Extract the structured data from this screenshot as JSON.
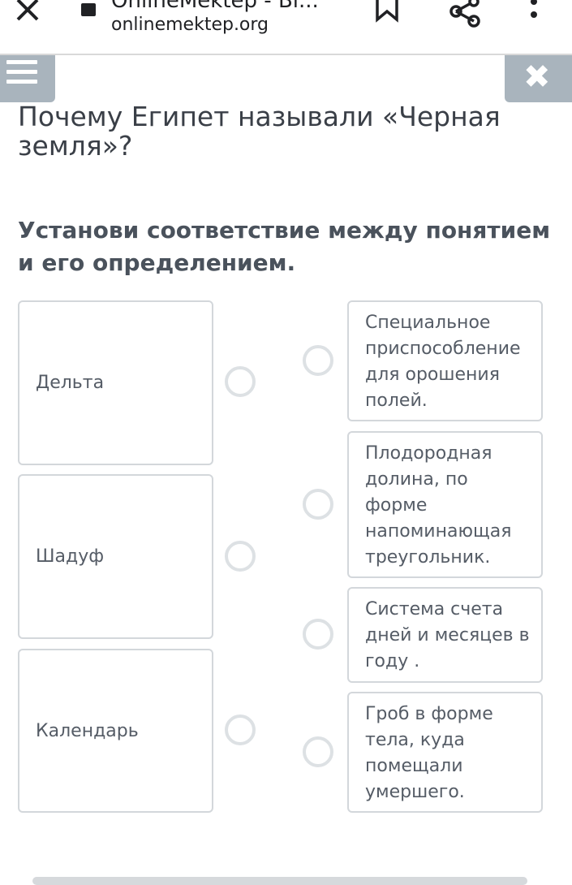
{
  "browser": {
    "page_title": "OnlineMektep - Bi...",
    "url": "onlinemektep.org"
  },
  "quiz": {
    "question": "Почему Египет называли «Черная земля»?",
    "instruction": "Установи соответствие между понятием и его определением.",
    "terms": [
      {
        "label": "Дельта"
      },
      {
        "label": "Шадуф"
      },
      {
        "label": "Календарь"
      }
    ],
    "definitions": [
      {
        "label": "Специальное приспособление для орошения полей."
      },
      {
        "label": "Плодородная долина, по форме напоминающая треугольник."
      },
      {
        "label": "Система счета дней и месяцев в году ."
      },
      {
        "label": "Гроб в форме тела, куда помещали умершего."
      }
    ]
  },
  "icons": {
    "close": "close-icon",
    "lock": "lock-icon",
    "bookmark": "bookmark-icon",
    "share": "share-icon",
    "more": "more-vert-icon",
    "menu": "hamburger-menu-icon",
    "quiz_close": "close-icon"
  },
  "colors": {
    "tab_gray": "#a9b4bd",
    "card_border": "#d3d7db",
    "radio_border": "#dde1e4",
    "text": "#3f4650"
  }
}
